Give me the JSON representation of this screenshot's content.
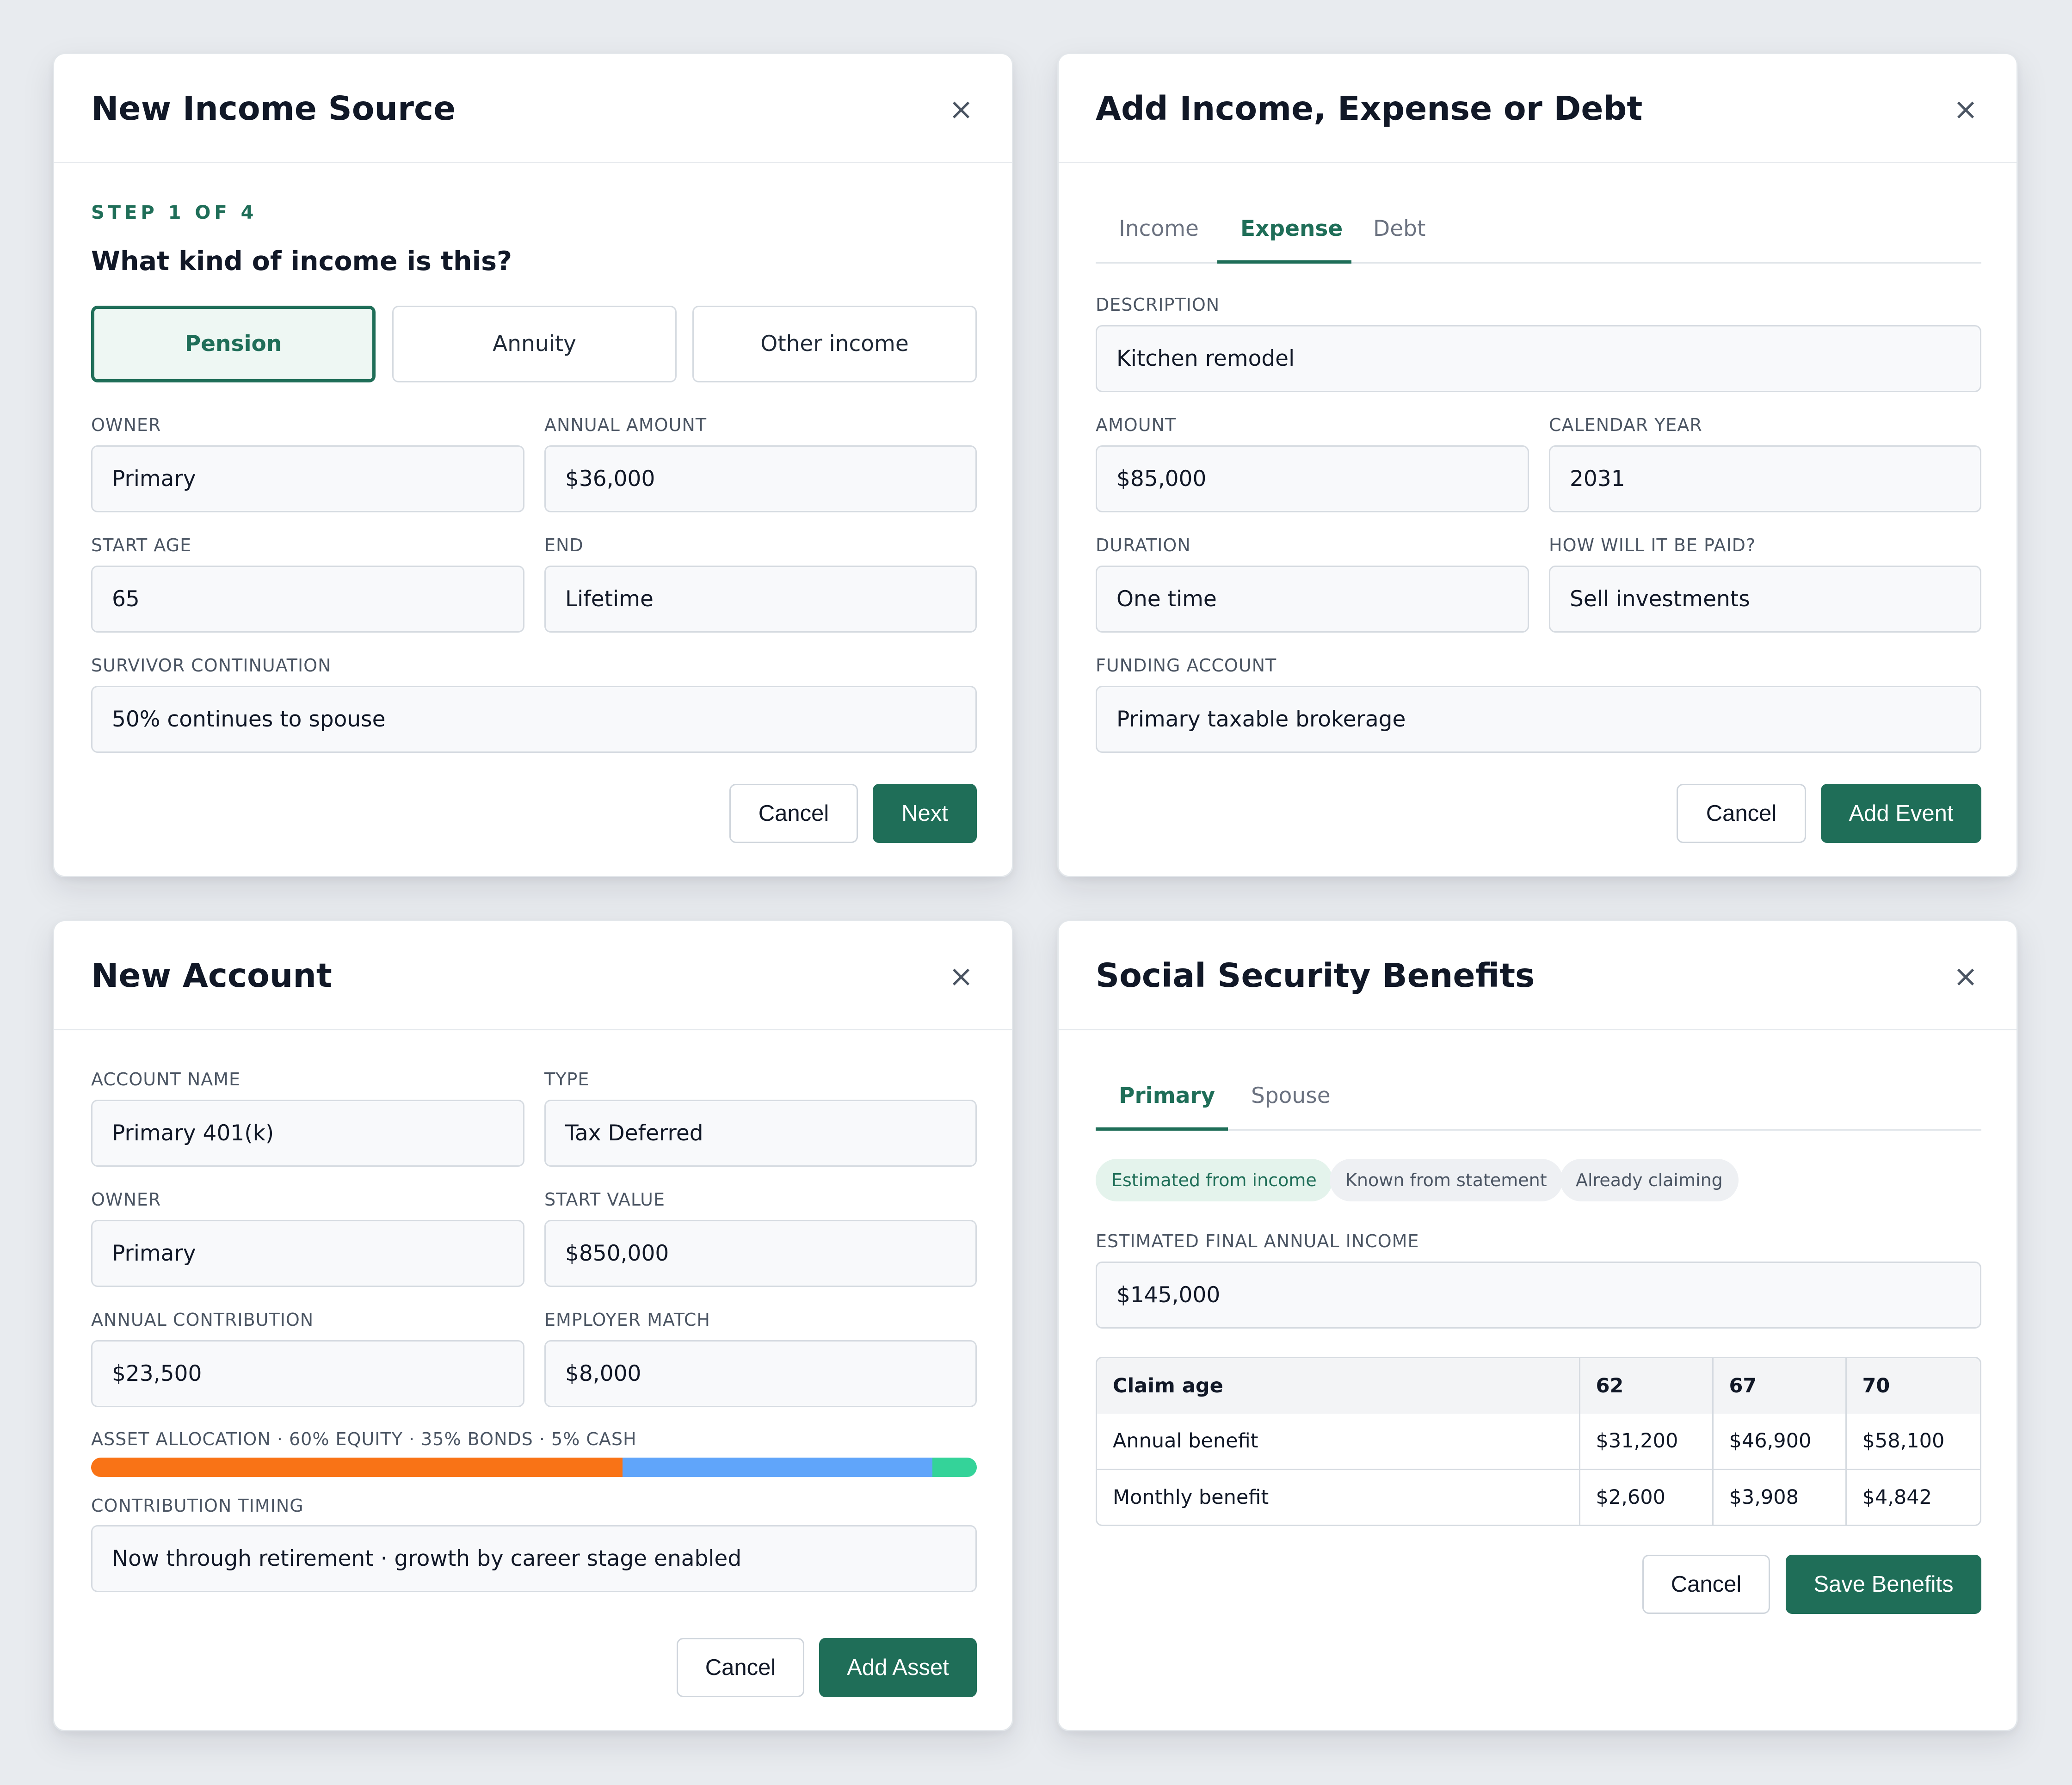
{
  "income_dialog": {
    "title": "New Income Source",
    "step": "STEP 1 OF 4",
    "question": "What kind of income is this?",
    "options": [
      "Pension",
      "Annuity",
      "Other income"
    ],
    "selected_option": "Pension",
    "owner_label": "OWNER",
    "owner_value": "Primary",
    "amount_label": "ANNUAL AMOUNT",
    "amount_value": "$36,000",
    "start_age_label": "START AGE",
    "start_age_value": "65",
    "end_label": "END",
    "end_value": "Lifetime",
    "survivor_label": "SURVIVOR CONTINUATION",
    "survivor_value": "50% continues to spouse",
    "cancel_label": "Cancel",
    "next_label": "Next"
  },
  "event_dialog": {
    "title": "Add Income, Expense or Debt",
    "tabs": [
      "Income",
      "Expense",
      "Debt"
    ],
    "active_tab": "Expense",
    "description_label": "DESCRIPTION",
    "description_value": "Kitchen remodel",
    "amount_label": "AMOUNT",
    "amount_value": "$85,000",
    "year_label": "CALENDAR YEAR",
    "year_value": "2031",
    "duration_label": "DURATION",
    "duration_value": "One time",
    "paid_label": "HOW WILL IT BE PAID?",
    "paid_value": "Sell investments",
    "funding_label": "FUNDING ACCOUNT",
    "funding_value": "Primary taxable brokerage",
    "cancel_label": "Cancel",
    "submit_label": "Add Event"
  },
  "account_dialog": {
    "title": "New Account",
    "name_label": "ACCOUNT NAME",
    "name_value": "Primary 401(k)",
    "type_label": "TYPE",
    "type_value": "Tax Deferred",
    "owner_label": "OWNER",
    "owner_value": "Primary",
    "start_value_label": "START VALUE",
    "start_value_value": "$850,000",
    "contribution_label": "ANNUAL CONTRIBUTION",
    "contribution_value": "$23,500",
    "match_label": "EMPLOYER MATCH",
    "match_value": "$8,000",
    "allocation_label": "ASSET ALLOCATION · 60% EQUITY · 35% BONDS · 5% CASH",
    "allocation": [
      {
        "segment": "equity",
        "percent": 60,
        "color": "#f97316"
      },
      {
        "segment": "bonds",
        "percent": 35,
        "color": "#60a5fa"
      },
      {
        "segment": "cash",
        "percent": 5,
        "color": "#34d399"
      }
    ],
    "timing_label": "CONTRIBUTION TIMING",
    "timing_value": "Now through retirement · growth by career stage enabled",
    "cancel_label": "Cancel",
    "submit_label": "Add Asset"
  },
  "ss_dialog": {
    "title": "Social Security Benefits",
    "tabs": [
      "Primary",
      "Spouse"
    ],
    "active_tab": "Primary",
    "chips": [
      "Estimated from income",
      "Known from statement",
      "Already claiming"
    ],
    "active_chip": "Estimated from income",
    "income_label": "ESTIMATED FINAL ANNUAL INCOME",
    "income_value": "$145,000",
    "table": {
      "headers": [
        "Claim age",
        "62",
        "67",
        "70"
      ],
      "rows": [
        [
          "Annual benefit",
          "$31,200",
          "$46,900",
          "$58,100"
        ],
        [
          "Monthly benefit",
          "$2,600",
          "$3,908",
          "$4,842"
        ]
      ]
    },
    "cancel_label": "Cancel",
    "submit_label": "Save Benefits"
  },
  "colors": {
    "accent": "#1f6e58",
    "accent_light": "#eef7f3",
    "background": "#e8ebef"
  }
}
